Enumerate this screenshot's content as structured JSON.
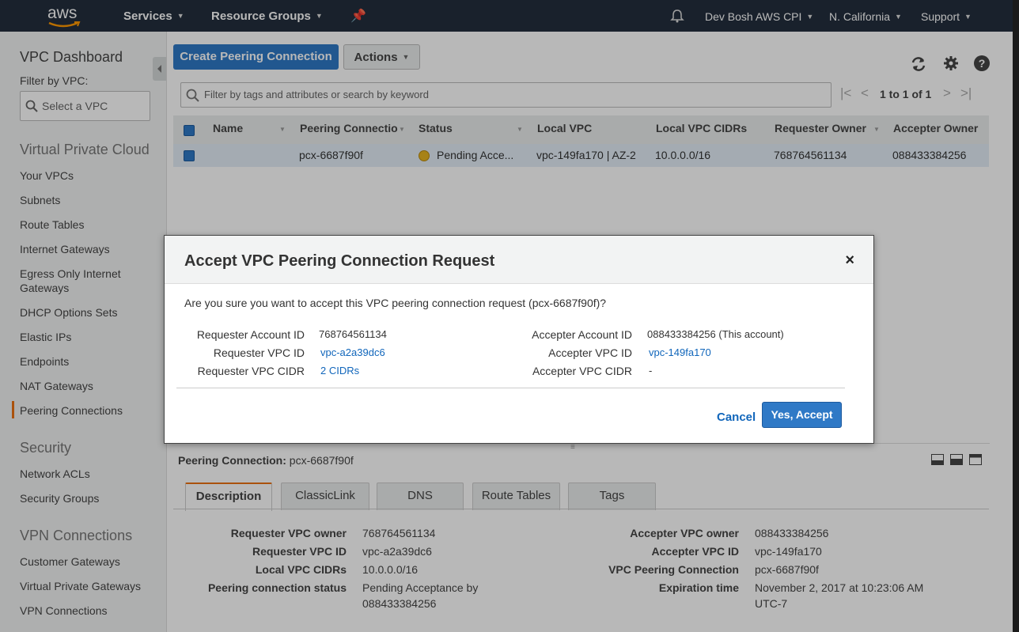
{
  "topnav": {
    "logo_text": "aws",
    "services": "Services",
    "resource_groups": "Resource Groups",
    "account": "Dev Bosh AWS CPI",
    "region": "N. California",
    "support": "Support"
  },
  "sidebar": {
    "title": "VPC Dashboard",
    "filter_label": "Filter by VPC:",
    "filter_placeholder": "Select a VPC",
    "sections": [
      {
        "title": "Virtual Private Cloud",
        "items": [
          "Your VPCs",
          "Subnets",
          "Route Tables",
          "Internet Gateways",
          "Egress Only Internet Gateways",
          "DHCP Options Sets",
          "Elastic IPs",
          "Endpoints",
          "NAT Gateways",
          "Peering Connections"
        ]
      },
      {
        "title": "Security",
        "items": [
          "Network ACLs",
          "Security Groups"
        ]
      },
      {
        "title": "VPN Connections",
        "items": [
          "Customer Gateways",
          "Virtual Private Gateways",
          "VPN Connections"
        ]
      }
    ],
    "active_item": "Peering Connections"
  },
  "toolbar": {
    "create_label": "Create Peering Connection",
    "actions_label": "Actions",
    "search_placeholder": "Filter by tags and attributes or search by keyword",
    "pagination": "1 to 1 of 1"
  },
  "table": {
    "columns": [
      "Name",
      "Peering Connectio",
      "Status",
      "Local VPC",
      "Local VPC CIDRs",
      "Requester Owner",
      "Accepter Owner"
    ],
    "rows": [
      {
        "name": "",
        "peering_connection": "pcx-6687f90f",
        "status": "Pending Acce...",
        "local_vpc": "vpc-149fa170 | AZ-2",
        "local_cidrs": "10.0.0.0/16",
        "requester_owner": "768764561134",
        "accepter_owner": "088433384256"
      }
    ]
  },
  "modal": {
    "title": "Accept VPC Peering Connection Request",
    "close_glyph": "×",
    "question": "Are you sure you want to accept this VPC peering connection request (pcx-6687f90f)?",
    "left": [
      {
        "label": "Requester Account ID",
        "value": "768764561134",
        "link": false
      },
      {
        "label": "Requester VPC ID",
        "value": "vpc-a2a39dc6",
        "link": true
      },
      {
        "label": "Requester VPC CIDR",
        "value": "2 CIDRs",
        "link": true
      }
    ],
    "right": [
      {
        "label": "Accepter Account ID",
        "value": "088433384256 (This account)",
        "link": false
      },
      {
        "label": "Accepter VPC ID",
        "value": "vpc-149fa170",
        "link": true
      },
      {
        "label": "Accepter VPC CIDR",
        "value": "-",
        "link": false
      }
    ],
    "cancel_label": "Cancel",
    "accept_label": "Yes, Accept"
  },
  "detail": {
    "heading_label": "Peering Connection:",
    "heading_value": "pcx-6687f90f",
    "tabs": [
      "Description",
      "ClassicLink",
      "DNS",
      "Route Tables",
      "Tags"
    ],
    "active_tab": "Description",
    "left": [
      {
        "label": "Requester VPC owner",
        "value": "768764561134"
      },
      {
        "label": "Requester VPC ID",
        "value": "vpc-a2a39dc6"
      },
      {
        "label": "Local VPC CIDRs",
        "value": "10.0.0.0/16"
      },
      {
        "label": "Peering connection status",
        "value": "Pending Acceptance by",
        "value2": "088433384256"
      }
    ],
    "right": [
      {
        "label": "Accepter VPC owner",
        "value": "088433384256"
      },
      {
        "label": "Accepter VPC ID",
        "value": "vpc-149fa170"
      },
      {
        "label": "VPC Peering Connection",
        "value": "pcx-6687f90f"
      },
      {
        "label": "Expiration time",
        "value": "November 2, 2017 at 10:23:06 AM",
        "value2": "UTC-7"
      }
    ]
  },
  "colors": {
    "nav_bg": "#232f3e",
    "primary": "#2f79c6",
    "accent": "#ec7211",
    "link": "#1166bb",
    "status_pending": "#e8b520"
  },
  "icons": [
    "aws-logo-icon",
    "pin-icon",
    "bell-icon",
    "search-icon",
    "refresh-icon",
    "gear-icon",
    "help-icon",
    "collapse-sidebar-icon",
    "first-page-icon",
    "prev-page-icon",
    "next-page-icon",
    "last-page-icon",
    "status-dot-icon",
    "close-icon",
    "panel-layout-icon"
  ]
}
